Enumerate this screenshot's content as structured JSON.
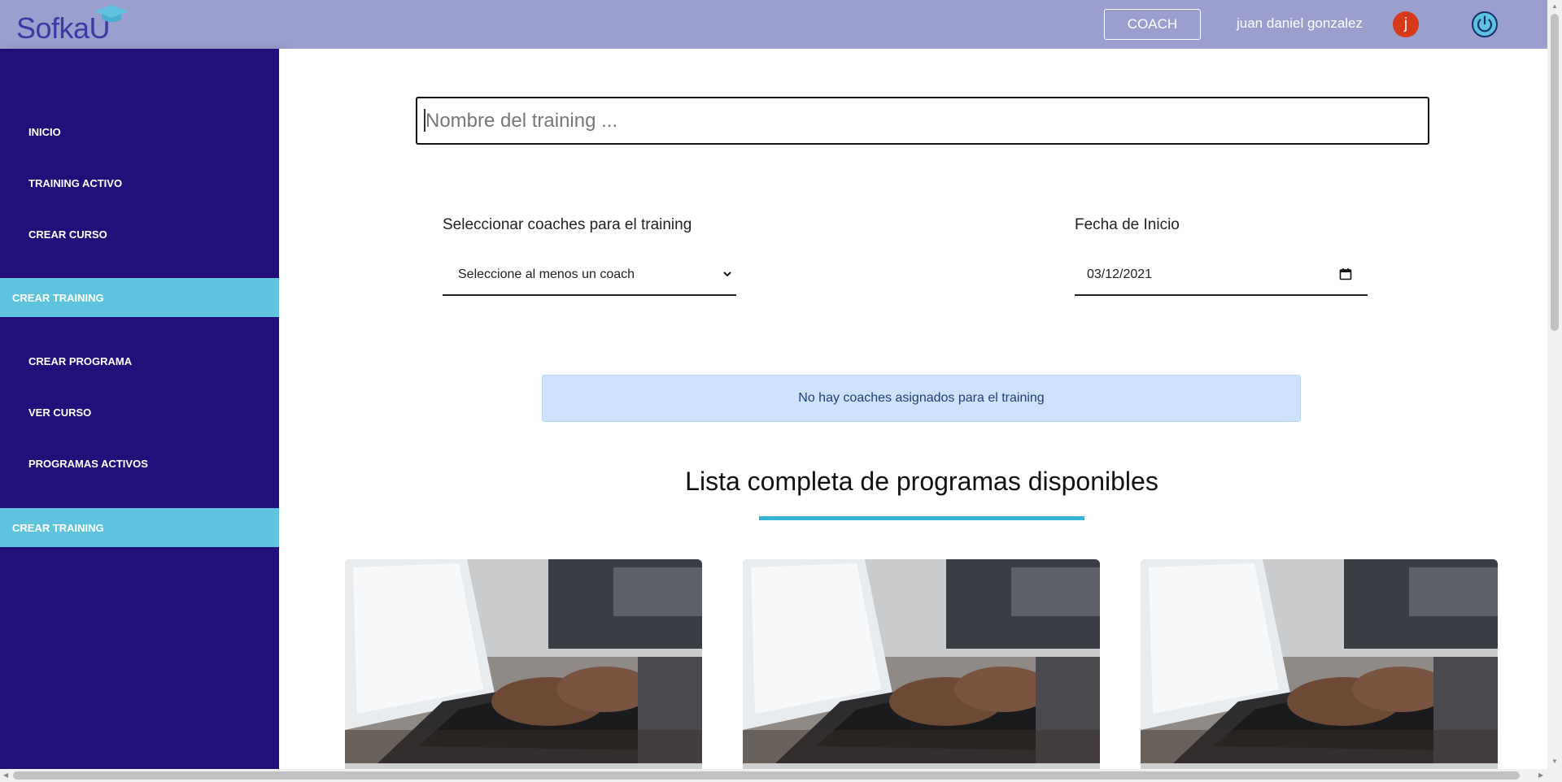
{
  "header": {
    "logo_text": "SofkaU",
    "role_button": "COACH",
    "user_name": "juan daniel gonzalez",
    "avatar_initial": "j",
    "power_icon": "power-icon"
  },
  "sidebar": {
    "items": [
      {
        "label": "INICIO"
      },
      {
        "label": "TRAINING ACTIVO"
      },
      {
        "label": "CREAR CURSO"
      },
      {
        "label": "CREAR TRAINING"
      },
      {
        "label": "CREAR PROGRAMA"
      },
      {
        "label": "VER CURSO"
      },
      {
        "label": "PROGRAMAS ACTIVOS"
      },
      {
        "label": "CREAR TRAINING"
      }
    ],
    "active_color": "#5fc3dd",
    "background": "#22107a"
  },
  "form": {
    "training_name_placeholder": "Nombre del training ...",
    "coaches_label": "Seleccionar coaches para el training",
    "coaches_select_value": "Seleccione al menos un coach",
    "start_date_label": "Fecha de Inicio",
    "start_date_value": "03/12/2021"
  },
  "alert": {
    "message": "No hay coaches asignados para el training"
  },
  "programs": {
    "title": "Lista completa de programas disponibles",
    "cards": [
      {
        "image": "laptop-typing-photo"
      },
      {
        "image": "laptop-typing-photo"
      },
      {
        "image": "laptop-typing-photo"
      }
    ]
  },
  "colors": {
    "header_bg": "#9a9fcd",
    "accent": "#39b3d3",
    "avatar_bg": "#d63a1a",
    "alert_bg": "#cfe2fd"
  }
}
